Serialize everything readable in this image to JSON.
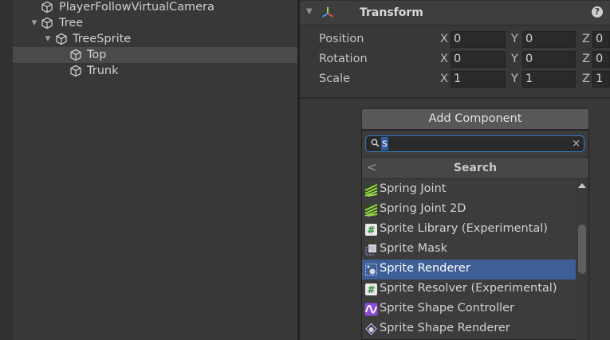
{
  "hierarchy": {
    "items": [
      {
        "label": "PlayerFollowVirtualCamera",
        "expanded": null,
        "selected": false
      },
      {
        "label": "Tree",
        "expanded": true,
        "selected": false
      },
      {
        "label": "TreeSprite",
        "expanded": true,
        "selected": false
      },
      {
        "label": "Top",
        "expanded": null,
        "selected": true
      },
      {
        "label": "Trunk",
        "expanded": null,
        "selected": false
      }
    ]
  },
  "inspector": {
    "transform": {
      "title": "Transform",
      "help_icon": "?",
      "rows": [
        {
          "label": "Position",
          "x": "0",
          "y": "0",
          "z": "0"
        },
        {
          "label": "Rotation",
          "x": "0",
          "y": "0",
          "z": "0"
        },
        {
          "label": "Scale",
          "x": "1",
          "y": "1",
          "z": "1"
        }
      ],
      "axis_labels": {
        "x": "X",
        "y": "Y",
        "z": "Z"
      }
    },
    "add_component_label": "Add Component",
    "search": {
      "value": "s",
      "header": "Search",
      "clear_icon": "×",
      "back_icon": "<",
      "results": [
        {
          "label": "Spring Joint",
          "icon": "spring-joint-icon"
        },
        {
          "label": "Spring Joint 2D",
          "icon": "spring-joint-2d-icon"
        },
        {
          "label": "Sprite Library (Experimental)",
          "icon": "script-hash-icon"
        },
        {
          "label": "Sprite Mask",
          "icon": "sprite-mask-icon"
        },
        {
          "label": "Sprite Renderer",
          "icon": "sprite-renderer-icon",
          "highlighted": true
        },
        {
          "label": "Sprite Resolver (Experimental)",
          "icon": "script-hash-icon"
        },
        {
          "label": "Sprite Shape Controller",
          "icon": "sprite-shape-controller-icon"
        },
        {
          "label": "Sprite Shape Renderer",
          "icon": "sprite-shape-renderer-icon"
        }
      ]
    }
  },
  "colors": {
    "selection": "#3e5f96",
    "search_border": "#3a79bb",
    "spring_green": "#9bd84a",
    "shape_purple": "#8a4bd8"
  }
}
